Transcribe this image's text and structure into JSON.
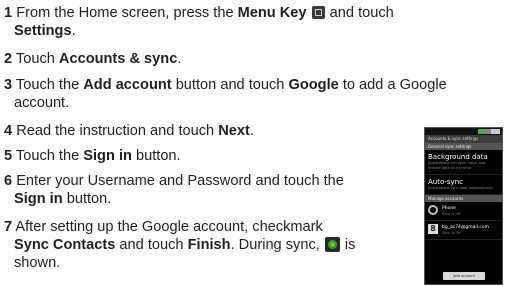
{
  "steps": [
    {
      "num": "1",
      "parts": [
        "From the Home screen, press the ",
        "Menu Key",
        " and touch",
        "Settings",
        "."
      ]
    },
    {
      "num": "2",
      "parts": [
        "Touch ",
        "Accounts & sync",
        "."
      ]
    },
    {
      "num": "3",
      "parts": [
        "Touch the ",
        "Add account",
        " button and touch ",
        "Google",
        " to add a Google",
        "account."
      ]
    },
    {
      "num": "4",
      "parts": [
        "Read the instruction and touch ",
        "Next",
        "."
      ]
    },
    {
      "num": "5",
      "parts": [
        "Touch the ",
        "Sign in",
        " button."
      ]
    },
    {
      "num": "6",
      "parts": [
        "Enter your Username and Password and touch the",
        "Sign in",
        " button."
      ]
    },
    {
      "num": "7",
      "parts": [
        "After setting up the Google account, checkmark",
        "Sync Contacts",
        " and touch ",
        "Finish",
        ". During sync, ",
        " is",
        "shown."
      ]
    }
  ],
  "icons": {
    "menu_key": "menu-key-icon",
    "sync": "sync-icon"
  },
  "phone": {
    "title": "Accounts & sync settings",
    "section_general": "General sync settings",
    "bg_data_title": "Background data",
    "bg_data_desc": "Applications can sync, send, and receive data at any time",
    "auto_sync_title": "Auto-sync",
    "auto_sync_desc": "Applications sync data automatically",
    "section_manage": "Manage accounts",
    "account1_name": "Phone",
    "account1_status": "Sync is Off",
    "account2_name": "bg_ac74@gmail.com",
    "account2_status": "Sync is Off",
    "add_button": "Add account"
  }
}
